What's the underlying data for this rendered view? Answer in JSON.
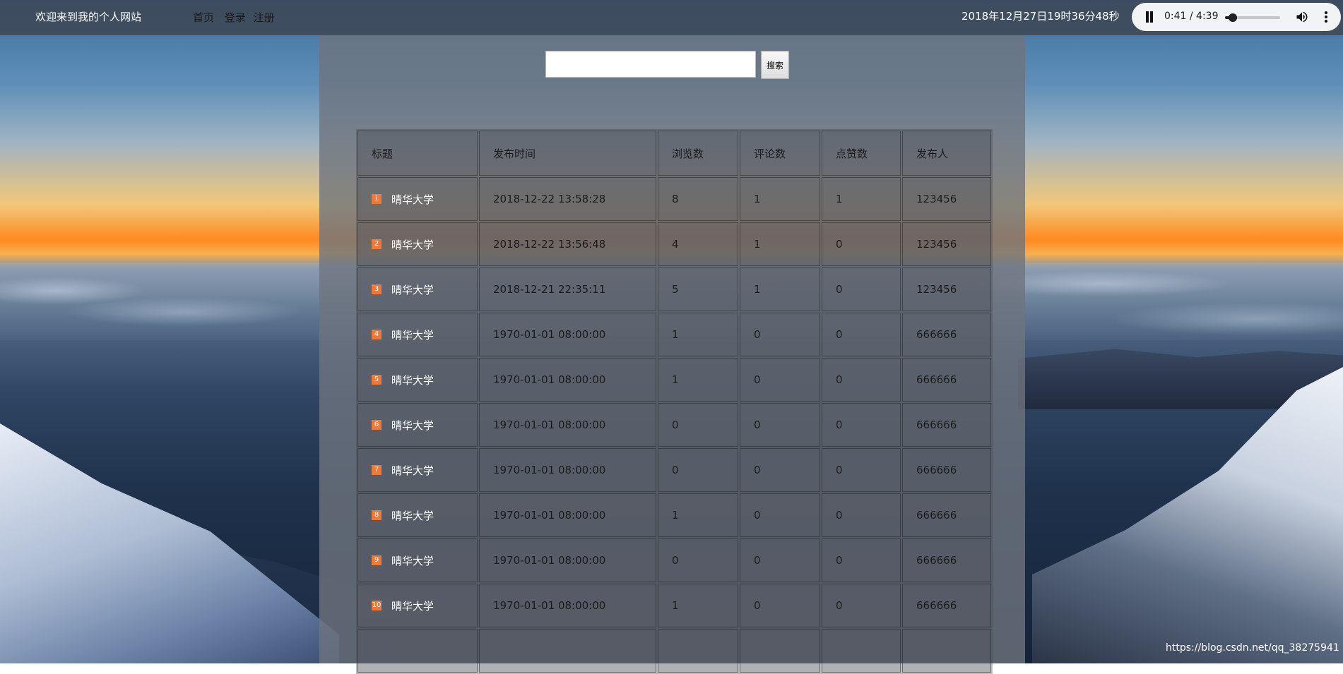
{
  "header": {
    "site_title": "欢迎来到我的个人网站",
    "nav": {
      "home": "首页",
      "login": "登录",
      "register": "注册"
    },
    "datetime": "2018年12月27日19时36分48秒"
  },
  "player": {
    "time": "0:41 / 4:39",
    "progress": 0.147,
    "icons": {
      "play_pause": "pause-icon",
      "volume": "volume-icon",
      "more": "more-vert-icon"
    }
  },
  "search": {
    "value": "",
    "button_label": "搜索"
  },
  "table": {
    "headers": [
      "标题",
      "发布时间",
      "浏览数",
      "评论数",
      "点赞数",
      "发布人"
    ],
    "rows": [
      {
        "rank": "1",
        "title": "晴华大学",
        "time": "2018-12-22 13:58:28",
        "views": "8",
        "comments": "1",
        "likes": "1",
        "author": "123456"
      },
      {
        "rank": "2",
        "title": "晴华大学",
        "time": "2018-12-22 13:56:48",
        "views": "4",
        "comments": "1",
        "likes": "0",
        "author": "123456"
      },
      {
        "rank": "3",
        "title": "晴华大学",
        "time": "2018-12-21 22:35:11",
        "views": "5",
        "comments": "1",
        "likes": "0",
        "author": "123456"
      },
      {
        "rank": "4",
        "title": "晴华大学",
        "time": "1970-01-01 08:00:00",
        "views": "1",
        "comments": "0",
        "likes": "0",
        "author": "666666"
      },
      {
        "rank": "5",
        "title": "晴华大学",
        "time": "1970-01-01 08:00:00",
        "views": "1",
        "comments": "0",
        "likes": "0",
        "author": "666666"
      },
      {
        "rank": "6",
        "title": "晴华大学",
        "time": "1970-01-01 08:00:00",
        "views": "0",
        "comments": "0",
        "likes": "0",
        "author": "666666"
      },
      {
        "rank": "7",
        "title": "晴华大学",
        "time": "1970-01-01 08:00:00",
        "views": "0",
        "comments": "0",
        "likes": "0",
        "author": "666666"
      },
      {
        "rank": "8",
        "title": "晴华大学",
        "time": "1970-01-01 08:00:00",
        "views": "1",
        "comments": "0",
        "likes": "0",
        "author": "666666"
      },
      {
        "rank": "9",
        "title": "晴华大学",
        "time": "1970-01-01 08:00:00",
        "views": "0",
        "comments": "0",
        "likes": "0",
        "author": "666666"
      },
      {
        "rank": "10",
        "title": "晴华大学",
        "time": "1970-01-01 08:00:00",
        "views": "1",
        "comments": "0",
        "likes": "0",
        "author": "666666"
      }
    ]
  },
  "watermark": "https://blog.csdn.net/qq_38275941",
  "colors": {
    "rank_badge": "#ec7a3a",
    "topbar": "#3c444e"
  }
}
